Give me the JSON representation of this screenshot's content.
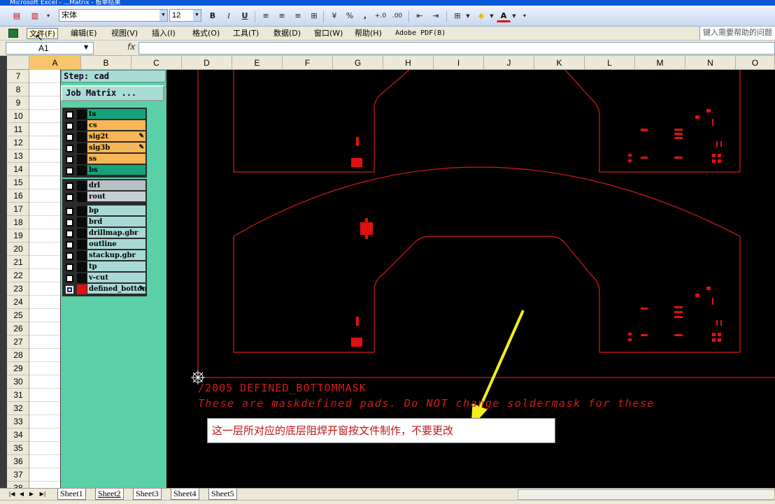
{
  "window": {
    "title": "Microsoft Excel - ...Matrix - 板单结果"
  },
  "toolbar": {
    "font_name": "宋体",
    "font_size": "12",
    "bold": "B",
    "italic": "I",
    "underline": "U",
    "percent": "%",
    "comma": ",",
    "font_color_label": "A"
  },
  "menu": {
    "items": [
      "文件(F)",
      "编辑(E)",
      "视图(V)",
      "插入(I)",
      "格式(O)",
      "工具(T)",
      "数据(D)",
      "窗口(W)",
      "帮助(H)",
      "Adobe PDF(B)"
    ],
    "help_placeholder": "键入需要帮助的问题"
  },
  "formula_bar": {
    "name_box": "A1",
    "fx": "fx"
  },
  "columns": [
    "A",
    "B",
    "C",
    "D",
    "E",
    "F",
    "G",
    "H",
    "I",
    "J",
    "K",
    "L",
    "M",
    "N",
    "O"
  ],
  "rows": [
    "7",
    "8",
    "9",
    "10",
    "11",
    "12",
    "13",
    "14",
    "15",
    "16",
    "17",
    "18",
    "19",
    "20",
    "21",
    "22",
    "23",
    "24",
    "25",
    "26",
    "27",
    "28",
    "29",
    "30",
    "31",
    "32",
    "33",
    "34",
    "35",
    "36",
    "37",
    "38"
  ],
  "genesis": {
    "step_label": "Step: cad",
    "matrix_button": "Job Matrix ...",
    "groups": [
      {
        "layers": [
          {
            "name": "ts",
            "color": "#16a37a",
            "checked": false,
            "pen": false
          },
          {
            "name": "cs",
            "color": "#f7b657",
            "checked": false,
            "pen": false
          },
          {
            "name": "sig2t",
            "color": "#f7b657",
            "checked": false,
            "pen": true
          },
          {
            "name": "sig3b",
            "color": "#f7b657",
            "checked": false,
            "pen": true
          },
          {
            "name": "ss",
            "color": "#f7b657",
            "checked": false,
            "pen": false
          },
          {
            "name": "bs",
            "color": "#16a37a",
            "checked": false,
            "pen": false
          }
        ]
      },
      {
        "layers": [
          {
            "name": "drl",
            "color": "#b7c0c6",
            "checked": false,
            "pen": false
          },
          {
            "name": "rout",
            "color": "#c8cfd4",
            "checked": false,
            "pen": false
          }
        ]
      },
      {
        "layers": [
          {
            "name": "bp",
            "color": "#a8d9d6",
            "checked": false,
            "pen": false
          },
          {
            "name": "brd",
            "color": "#a8d9d6",
            "checked": false,
            "pen": false
          },
          {
            "name": "drillmap.gbr",
            "color": "#a8d9d6",
            "checked": false,
            "pen": false
          },
          {
            "name": "outline",
            "color": "#a8d9d6",
            "checked": false,
            "pen": false
          },
          {
            "name": "stackup.gbr",
            "color": "#a8d9d6",
            "checked": false,
            "pen": false
          },
          {
            "name": "tp",
            "color": "#a8d9d6",
            "checked": false,
            "pen": false
          },
          {
            "name": "v-cut",
            "color": "#a8d9d6",
            "checked": false,
            "pen": false
          },
          {
            "name": "defined_bottommask",
            "color": "#a8d9d6",
            "checked": true,
            "pen": true,
            "swatch": "#e01010"
          }
        ]
      }
    ]
  },
  "cad": {
    "line1": "/2005  DEFINED_BOTTOMMASK",
    "line2": "These are maskdefined pads. Do NOT change soldermask for these",
    "callout": "这一层所对应的底层阻焊开窗按文件制作，不要更改",
    "stroke_color": "#d81a1a",
    "arrow_color": "#f0f01a"
  },
  "sheets": {
    "tabs": [
      "Sheet1",
      "Sheet2",
      "Sheet3",
      "Sheet4",
      "Sheet5"
    ],
    "active": "Sheet2"
  }
}
